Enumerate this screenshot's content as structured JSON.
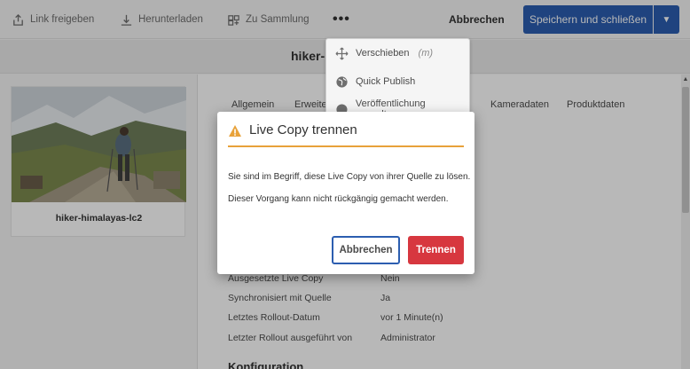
{
  "toolbar": {
    "share_label": "Link freigeben",
    "download_label": "Herunterladen",
    "collection_label": "Zu Sammlung",
    "more_label": "•••",
    "cancel_label": "Abbrechen",
    "save_label": "Speichern und schließen"
  },
  "title": "hiker-l",
  "asset": {
    "name": "hiker-himalayas-lc2"
  },
  "tabs": [
    "Allgemein",
    "Erweiter",
    "Kameradaten",
    "Produktdaten"
  ],
  "properties": [
    {
      "label": "Ausgesetzte Live Copy",
      "value": "Nein"
    },
    {
      "label": "Synchronisiert mit Quelle",
      "value": "Ja"
    },
    {
      "label": "Letztes Rollout-Datum",
      "value": "vor 1 Minute(n)"
    },
    {
      "label": "Letzter Rollout ausgeführt von",
      "value": "Administrator"
    }
  ],
  "section_heading": "Konfiguration",
  "popover": {
    "move_label": "Verschieben",
    "move_shortcut": "(m)",
    "quick_publish_label": "Quick Publish",
    "manage_publication_label": "Veröffentlichung verwalten"
  },
  "dialog": {
    "title": "Live Copy trennen",
    "text1": "Sie sind im Begriff, diese Live Copy von ihrer Quelle zu lösen.",
    "text2": "Dieser Vorgang kann nicht rückgängig gemacht werden.",
    "cancel_label": "Abbrechen",
    "confirm_label": "Trennen"
  },
  "colors": {
    "primary": "#2c5eb0",
    "danger": "#d7373f",
    "warning": "#e8a23a"
  }
}
